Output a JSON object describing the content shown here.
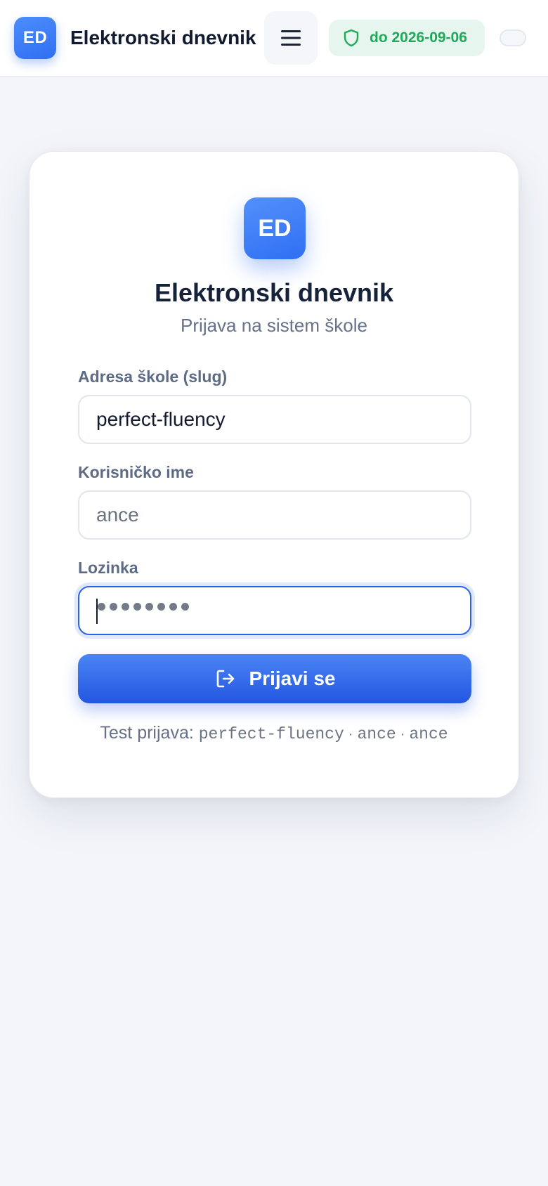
{
  "header": {
    "logo_text": "ED",
    "title": "Elektronski dnevnik",
    "menu_icon": "hamburger-icon",
    "license_icon": "shield-icon",
    "license_text": "do 2026-09-06"
  },
  "card": {
    "logo_text": "ED",
    "title": "Elektronski dnevnik",
    "subtitle": "Prijava na sistem škole",
    "fields": {
      "school": {
        "label": "Adresa škole (slug)",
        "value": "perfect-fluency"
      },
      "username": {
        "label": "Korisničko ime",
        "placeholder": "ance"
      },
      "password": {
        "label": "Lozinka",
        "masked_length": 8
      }
    },
    "submit": {
      "icon": "login-icon",
      "label": "Prijavi se"
    },
    "test_login": {
      "prefix": "Test prijava:",
      "school": "perfect-fluency",
      "username": "ance",
      "password": "ance",
      "separator": "·"
    }
  },
  "colors": {
    "accent": "#2f6ff3",
    "badge_green": "#1faa5a",
    "background": "#f3f5fa"
  }
}
